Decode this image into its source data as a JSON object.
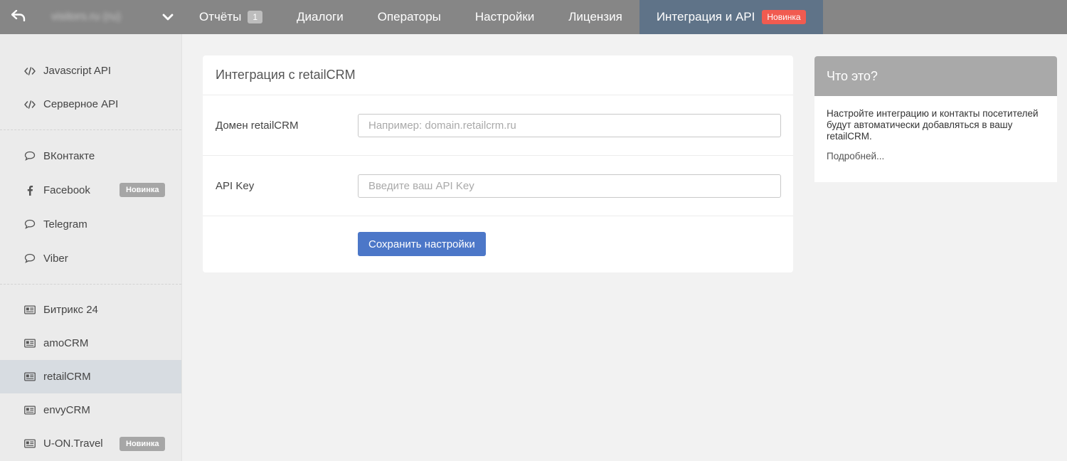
{
  "topbar": {
    "back_icon": "back-arrow-icon",
    "site_name": "visitors.ru (ru)",
    "chevron_icon": "chevron-down-icon",
    "nav": [
      {
        "label": "Отчёты",
        "count": "1"
      },
      {
        "label": "Диалоги"
      },
      {
        "label": "Операторы"
      },
      {
        "label": "Настройки"
      },
      {
        "label": "Лицензия"
      },
      {
        "label": "Интеграция и API",
        "badge": "Новинка",
        "active": true
      }
    ],
    "colors": {
      "bar": "#868686",
      "active_tab": "#5f7388",
      "badge": "#f15b50"
    }
  },
  "sidebar": {
    "groups": [
      {
        "items": [
          {
            "label": "Javascript API",
            "icon": "code-icon"
          },
          {
            "label": "Серверное API",
            "icon": "code-icon"
          }
        ]
      },
      {
        "items": [
          {
            "label": "ВКонтакте",
            "icon": "chat-bubble-icon"
          },
          {
            "label": "Facebook",
            "icon": "facebook-icon",
            "badge": "Новинка"
          },
          {
            "label": "Telegram",
            "icon": "chat-bubble-icon"
          },
          {
            "label": "Viber",
            "icon": "chat-bubble-icon"
          }
        ]
      },
      {
        "items": [
          {
            "label": "Битрикс 24",
            "icon": "id-card-icon"
          },
          {
            "label": "amoCRM",
            "icon": "id-card-icon"
          },
          {
            "label": "retailCRM",
            "icon": "id-card-icon",
            "active": true
          },
          {
            "label": "envyCRM",
            "icon": "id-card-icon"
          },
          {
            "label": "U-ON.Travel",
            "icon": "id-card-icon",
            "badge": "Новинка"
          }
        ]
      }
    ]
  },
  "main": {
    "title": "Интеграция с retailCRM",
    "domain": {
      "label": "Домен retailCRM",
      "placeholder": "Например: domain.retailcrm.ru",
      "value": ""
    },
    "api_key": {
      "label": "API Key",
      "placeholder": "Введите ваш API Key",
      "value": ""
    },
    "save_label": "Сохранить настройки",
    "colors": {
      "button": "#4c77c8"
    }
  },
  "info": {
    "title": "Что это?",
    "text": "Настройте интеграцию и контакты посетителей будут автоматически добавляться в вашу retailCRM.",
    "more_link": "Подробней..."
  }
}
